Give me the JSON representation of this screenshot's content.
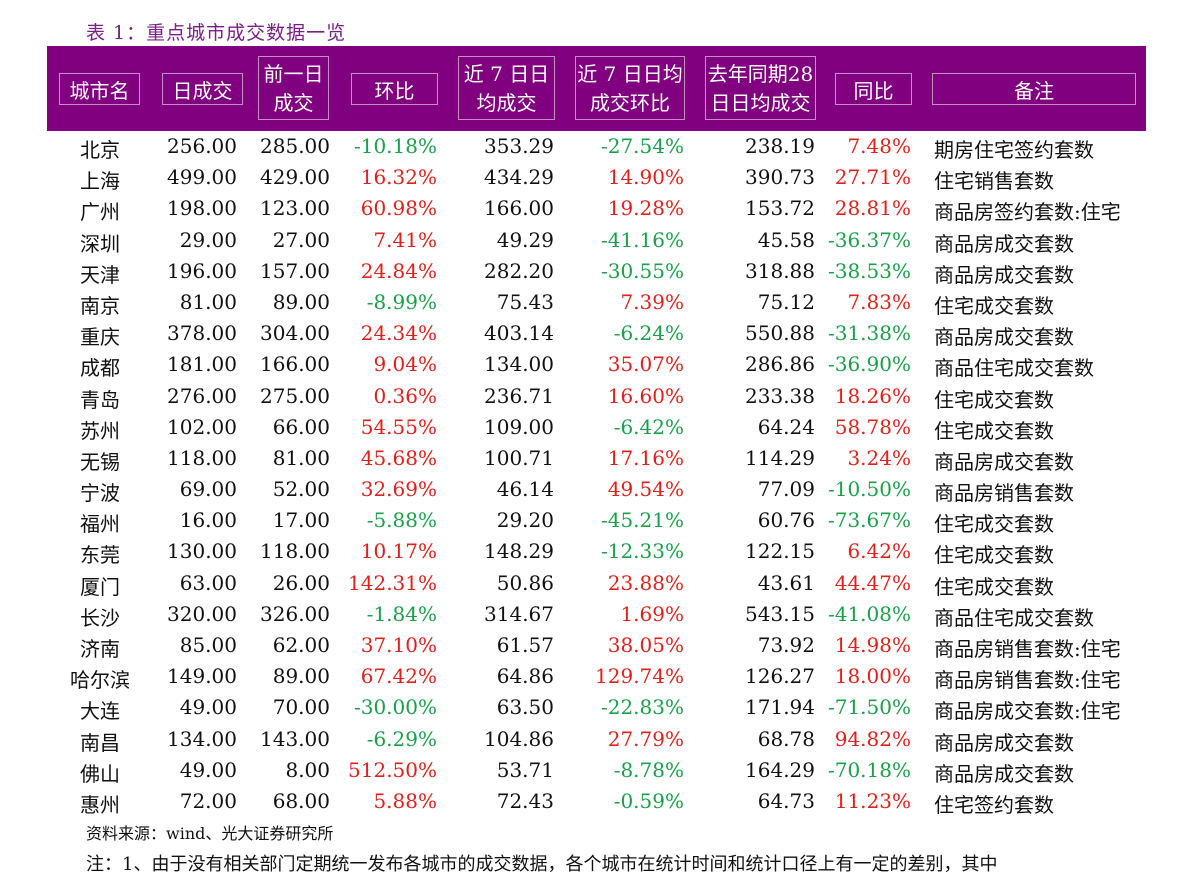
{
  "title": "表 1：重点城市成交数据一览",
  "headers": {
    "city": "城市名",
    "daily": "日成交",
    "prev_line1": "前一日",
    "prev_line2": "成交",
    "ring": "环比",
    "avg7_line1": "近 7 日日",
    "avg7_line2": "均成交",
    "avg7ring_line1": "近 7 日日均",
    "avg7ring_line2": "成交环比",
    "lastyear_line1": "去年同期28",
    "lastyear_line2": "日日均成交",
    "yoy": "同比",
    "note": "备注"
  },
  "rows": [
    {
      "city": "北京",
      "daily": "256.00",
      "prev": "285.00",
      "ring": "-10.18%",
      "avg7": "353.29",
      "avg7ring": "-27.54%",
      "lastyear": "238.19",
      "yoy": "7.48%",
      "note": "期房住宅签约套数"
    },
    {
      "city": "上海",
      "daily": "499.00",
      "prev": "429.00",
      "ring": "16.32%",
      "avg7": "434.29",
      "avg7ring": "14.90%",
      "lastyear": "390.73",
      "yoy": "27.71%",
      "note": "住宅销售套数"
    },
    {
      "city": "广州",
      "daily": "198.00",
      "prev": "123.00",
      "ring": "60.98%",
      "avg7": "166.00",
      "avg7ring": "19.28%",
      "lastyear": "153.72",
      "yoy": "28.81%",
      "note": "商品房签约套数:住宅"
    },
    {
      "city": "深圳",
      "daily": "29.00",
      "prev": "27.00",
      "ring": "7.41%",
      "avg7": "49.29",
      "avg7ring": "-41.16%",
      "lastyear": "45.58",
      "yoy": "-36.37%",
      "note": "商品房成交套数"
    },
    {
      "city": "天津",
      "daily": "196.00",
      "prev": "157.00",
      "ring": "24.84%",
      "avg7": "282.20",
      "avg7ring": "-30.55%",
      "lastyear": "318.88",
      "yoy": "-38.53%",
      "note": "商品房成交套数"
    },
    {
      "city": "南京",
      "daily": "81.00",
      "prev": "89.00",
      "ring": "-8.99%",
      "avg7": "75.43",
      "avg7ring": "7.39%",
      "lastyear": "75.12",
      "yoy": "7.83%",
      "note": "住宅成交套数"
    },
    {
      "city": "重庆",
      "daily": "378.00",
      "prev": "304.00",
      "ring": "24.34%",
      "avg7": "403.14",
      "avg7ring": "-6.24%",
      "lastyear": "550.88",
      "yoy": "-31.38%",
      "note": "商品房成交套数"
    },
    {
      "city": "成都",
      "daily": "181.00",
      "prev": "166.00",
      "ring": "9.04%",
      "avg7": "134.00",
      "avg7ring": "35.07%",
      "lastyear": "286.86",
      "yoy": "-36.90%",
      "note": "商品住宅成交套数"
    },
    {
      "city": "青岛",
      "daily": "276.00",
      "prev": "275.00",
      "ring": "0.36%",
      "avg7": "236.71",
      "avg7ring": "16.60%",
      "lastyear": "233.38",
      "yoy": "18.26%",
      "note": "住宅成交套数"
    },
    {
      "city": "苏州",
      "daily": "102.00",
      "prev": "66.00",
      "ring": "54.55%",
      "avg7": "109.00",
      "avg7ring": "-6.42%",
      "lastyear": "64.24",
      "yoy": "58.78%",
      "note": "住宅成交套数"
    },
    {
      "city": "无锡",
      "daily": "118.00",
      "prev": "81.00",
      "ring": "45.68%",
      "avg7": "100.71",
      "avg7ring": "17.16%",
      "lastyear": "114.29",
      "yoy": "3.24%",
      "note": "商品房成交套数"
    },
    {
      "city": "宁波",
      "daily": "69.00",
      "prev": "52.00",
      "ring": "32.69%",
      "avg7": "46.14",
      "avg7ring": "49.54%",
      "lastyear": "77.09",
      "yoy": "-10.50%",
      "note": "商品房销售套数"
    },
    {
      "city": "福州",
      "daily": "16.00",
      "prev": "17.00",
      "ring": "-5.88%",
      "avg7": "29.20",
      "avg7ring": "-45.21%",
      "lastyear": "60.76",
      "yoy": "-73.67%",
      "note": "住宅成交套数"
    },
    {
      "city": "东莞",
      "daily": "130.00",
      "prev": "118.00",
      "ring": "10.17%",
      "avg7": "148.29",
      "avg7ring": "-12.33%",
      "lastyear": "122.15",
      "yoy": "6.42%",
      "note": "住宅成交套数"
    },
    {
      "city": "厦门",
      "daily": "63.00",
      "prev": "26.00",
      "ring": "142.31%",
      "avg7": "50.86",
      "avg7ring": "23.88%",
      "lastyear": "43.61",
      "yoy": "44.47%",
      "note": "住宅成交套数"
    },
    {
      "city": "长沙",
      "daily": "320.00",
      "prev": "326.00",
      "ring": "-1.84%",
      "avg7": "314.67",
      "avg7ring": "1.69%",
      "lastyear": "543.15",
      "yoy": "-41.08%",
      "note": "商品住宅成交套数"
    },
    {
      "city": "济南",
      "daily": "85.00",
      "prev": "62.00",
      "ring": "37.10%",
      "avg7": "61.57",
      "avg7ring": "38.05%",
      "lastyear": "73.92",
      "yoy": "14.98%",
      "note": "商品房销售套数:住宅"
    },
    {
      "city": "哈尔滨",
      "daily": "149.00",
      "prev": "89.00",
      "ring": "67.42%",
      "avg7": "64.86",
      "avg7ring": "129.74%",
      "lastyear": "126.27",
      "yoy": "18.00%",
      "note": "商品房销售套数:住宅"
    },
    {
      "city": "大连",
      "daily": "49.00",
      "prev": "70.00",
      "ring": "-30.00%",
      "avg7": "63.50",
      "avg7ring": "-22.83%",
      "lastyear": "171.94",
      "yoy": "-71.50%",
      "note": "商品房成交套数:住宅"
    },
    {
      "city": "南昌",
      "daily": "134.00",
      "prev": "143.00",
      "ring": "-6.29%",
      "avg7": "104.86",
      "avg7ring": "27.79%",
      "lastyear": "68.78",
      "yoy": "94.82%",
      "note": "商品房成交套数"
    },
    {
      "city": "佛山",
      "daily": "49.00",
      "prev": "8.00",
      "ring": "512.50%",
      "avg7": "53.71",
      "avg7ring": "-8.78%",
      "lastyear": "164.29",
      "yoy": "-70.18%",
      "note": "商品房成交套数"
    },
    {
      "city": "惠州",
      "daily": "72.00",
      "prev": "68.00",
      "ring": "5.88%",
      "avg7": "72.43",
      "avg7ring": "-0.59%",
      "lastyear": "64.73",
      "yoy": "11.23%",
      "note": "住宅签约套数"
    }
  ],
  "source": "资料来源：wind、光大证券研究所",
  "footnote": "注：1、由于没有相关部门定期统一发布各城市的成交数据，各个城市在统计时间和统计口径上有一定的差别，其中",
  "colors": {
    "header_bg": "#800080",
    "title": "#7a1f86",
    "negative": "#1aa04a",
    "positive": "#e0201a"
  }
}
